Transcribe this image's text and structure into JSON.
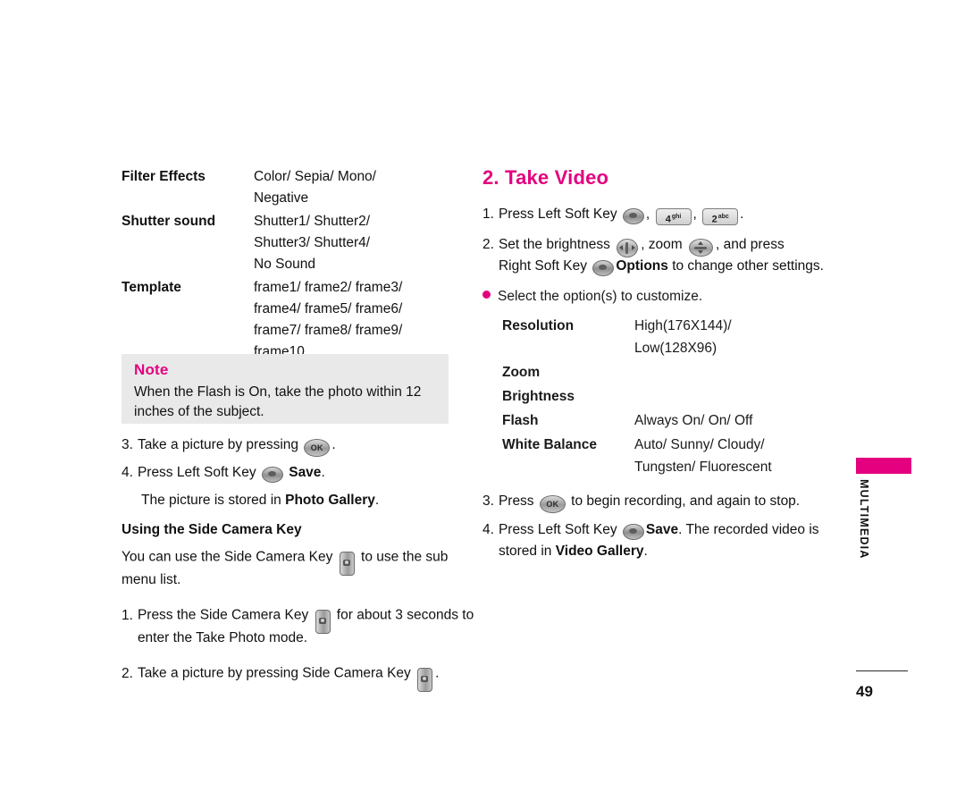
{
  "left_column": {
    "spec_table": [
      {
        "term": "Filter Effects",
        "lines": [
          "Color/ Sepia/ Mono/",
          "Negative"
        ]
      },
      {
        "term": "Shutter sound",
        "lines": [
          "Shutter1/ Shutter2/",
          "Shutter3/ Shutter4/",
          "No Sound"
        ]
      },
      {
        "term": "Template",
        "lines": [
          "frame1/ frame2/ frame3/",
          "frame4/ frame5/ frame6/",
          "frame7/ frame8/ frame9/",
          "frame10"
        ]
      }
    ],
    "note": {
      "title": "Note",
      "text": "When the Flash is On, take the photo within 12 inches of the subject."
    },
    "steps": [
      {
        "num": "3.",
        "parts": [
          {
            "type": "text",
            "value": "Take a picture by pressing "
          },
          {
            "type": "key",
            "icon": "ok-key",
            "label": "OK"
          },
          {
            "type": "text",
            "value": "."
          }
        ]
      },
      {
        "num": "4.",
        "parts": [
          {
            "type": "text",
            "value": "Press Left Soft Key "
          },
          {
            "type": "key",
            "icon": "soft-key-round",
            "label": ""
          },
          {
            "type": "bold",
            "value": " Save"
          },
          {
            "type": "text",
            "value": "."
          }
        ]
      }
    ],
    "stored_line": {
      "prefix": "The picture is stored in ",
      "bold": "Photo Gallery",
      "suffix": "."
    },
    "subsection_title": "Using the Side Camera Key",
    "side_intro": {
      "prefix": "You can use the Side Camera Key ",
      "suffix": " to use the sub menu list."
    },
    "side_steps": [
      {
        "num": "1.",
        "prefix": "Press the Side Camera Key ",
        "suffix": " for about 3 seconds to enter the Take Photo mode."
      },
      {
        "num": "2.",
        "prefix": "Take a picture by pressing Side Camera Key ",
        "suffix": "."
      }
    ]
  },
  "right_column": {
    "heading": "2. Take Video",
    "step1": {
      "num": "1.",
      "prefix": "Press Left Soft Key ",
      "key_num_1": "4",
      "key_num_1_sup": "ghi",
      "key_num_2": "2",
      "key_num_2_sup": "abc",
      "suffix": "."
    },
    "step2": {
      "num": "2.",
      "part1": "Set the brightness ",
      "part2": ", zoom ",
      "part3": ", and press",
      "part4": "Right Soft Key ",
      "bold": "Options",
      "part5": " to change other settings."
    },
    "bullet": "Select the option(s) to customize.",
    "options": [
      {
        "term": "Resolution",
        "lines": [
          "High(176X144)/",
          "Low(128X96)"
        ]
      },
      {
        "term": "Zoom",
        "lines": []
      },
      {
        "term": "Brightness",
        "lines": []
      },
      {
        "term": "Flash",
        "lines": [
          "Always On/ On/ Off"
        ]
      },
      {
        "term": "White Balance",
        "lines": [
          "Auto/ Sunny/ Cloudy/",
          "Tungsten/ Fluorescent"
        ]
      }
    ],
    "step3": {
      "num": "3.",
      "prefix": "Press ",
      "suffix": " to begin recording, and again to stop."
    },
    "step4": {
      "num": "4.",
      "prefix": "Press Left Soft Key ",
      "bold1": "Save",
      "mid": ". The recorded video is stored in ",
      "bold2": "Video Gallery",
      "suffix": "."
    }
  },
  "edge": {
    "section_label": "MULTIMEDIA",
    "page_number": "49",
    "accent_color": "#e4007f"
  }
}
